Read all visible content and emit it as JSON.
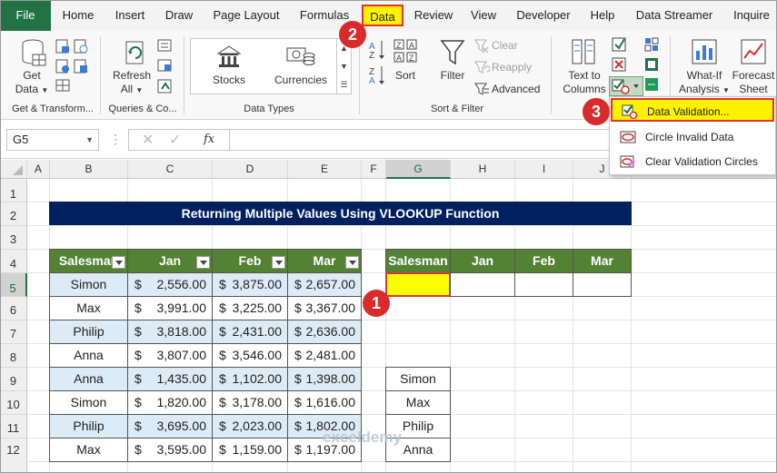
{
  "tabs": [
    "File",
    "Home",
    "Insert",
    "Draw",
    "Page Layout",
    "Formulas",
    "Data",
    "Review",
    "View",
    "Developer",
    "Help",
    "Data Streamer",
    "Inquire"
  ],
  "ribbon": {
    "get_data": "Get",
    "get_data2": "Data",
    "refresh": "Refresh",
    "refresh2": "All",
    "stocks": "Stocks",
    "currencies": "Currencies",
    "sort": "Sort",
    "filter": "Filter",
    "clear": "Clear",
    "reapply": "Reapply",
    "advanced": "Advanced",
    "text_to": "Text to",
    "columns": "Columns",
    "whatif": "What-If",
    "analysis": "Analysis",
    "forecast": "Forecast",
    "sheet": "Sheet",
    "groups": {
      "get_transform": "Get & Transform...",
      "queries": "Queries & Co...",
      "data_types": "Data Types",
      "sort_filter": "Sort & Filter"
    }
  },
  "formula_bar": {
    "name_box": "G5",
    "fx": "fx"
  },
  "columns": [
    "A",
    "B",
    "C",
    "D",
    "E",
    "F",
    "G",
    "H",
    "I",
    "J"
  ],
  "rows": [
    "1",
    "2",
    "3",
    "4",
    "5",
    "6",
    "7",
    "8",
    "9",
    "10",
    "11",
    "12"
  ],
  "sheet": {
    "title": "Returning Multiple Values Using VLOOKUP Function",
    "headers": [
      "Salesman",
      "Jan",
      "Feb",
      "Mar"
    ],
    "currency": "$",
    "data": [
      {
        "name": "Simon",
        "jan": "2,556.00",
        "feb": "3,875.00",
        "mar": "2,657.00"
      },
      {
        "name": "Max",
        "jan": "3,991.00",
        "feb": "3,225.00",
        "mar": "3,367.00"
      },
      {
        "name": "Philip",
        "jan": "3,818.00",
        "feb": "2,431.00",
        "mar": "2,636.00"
      },
      {
        "name": "Anna",
        "jan": "3,807.00",
        "feb": "3,546.00",
        "mar": "2,481.00"
      },
      {
        "name": "Anna",
        "jan": "1,435.00",
        "feb": "1,102.00",
        "mar": "1,398.00"
      },
      {
        "name": "Simon",
        "jan": "1,820.00",
        "feb": "3,178.00",
        "mar": "1,616.00"
      },
      {
        "name": "Philip",
        "jan": "3,695.00",
        "feb": "2,023.00",
        "mar": "1,802.00"
      },
      {
        "name": "Max",
        "jan": "3,595.00",
        "feb": "1,159.00",
        "mar": "1,197.00"
      }
    ],
    "lookup_headers": [
      "Salesman",
      "Jan",
      "Feb",
      "Mar"
    ],
    "list": [
      "Simon",
      "Max",
      "Philip",
      "Anna"
    ]
  },
  "menu": {
    "items": [
      "Data Validation...",
      "Circle Invalid Data",
      "Clear Validation Circles"
    ]
  },
  "badges": [
    "1",
    "2",
    "3"
  ],
  "watermark": "exceldemy",
  "colors": {
    "excel_green": "#217346",
    "header_green": "#548235",
    "title_navy": "#002060",
    "highlight_yellow": "#fff200",
    "callout_red": "#d92b2b",
    "alt_row": "#ddebf7"
  }
}
